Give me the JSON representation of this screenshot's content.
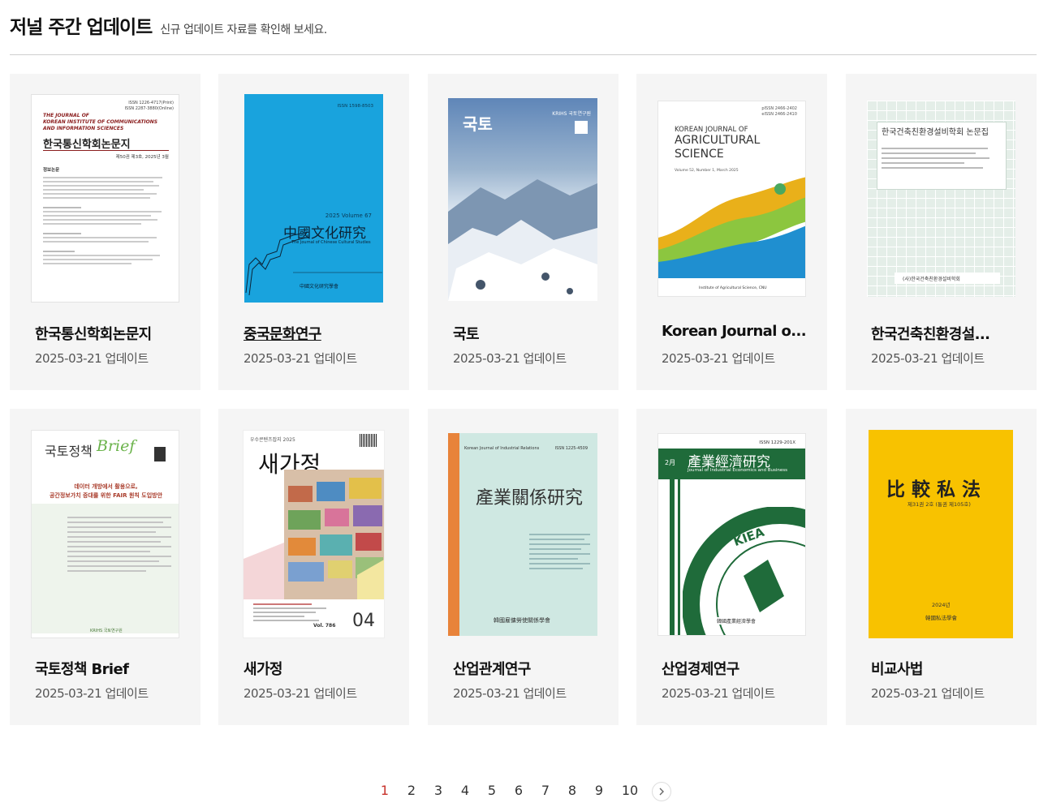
{
  "header": {
    "title": "저널 주간 업데이트",
    "subtitle": "신규 업데이트 자료를 확인해 보세요."
  },
  "journals": [
    {
      "name": "한국통신학회논문지",
      "date": "2025-03-21 업데이트",
      "cover": {
        "issn": "ISSN 1226-4717(Print)\nISSN 2287-3880(Online)",
        "en_title": "THE JOURNAL OF\nKOREAN INSTITUTE OF COMMUNICATIONS\nAND INFORMATION SCIENCES",
        "ko_title": "한국통신학회논문지",
        "issue": "제50권 제3호, 2025년 3월",
        "section": "정보논문"
      }
    },
    {
      "name": "중국문화연구",
      "date": "2025-03-21 업데이트",
      "cover": {
        "issn": "ISSN 1598-8503",
        "volume": "2025 Volume 67",
        "title": "中國文化研究",
        "subtitle": "The Journal of Chinese Cultural Studies",
        "publisher": "中國文化研究學會"
      }
    },
    {
      "name": "국토",
      "date": "2025-03-21 업데이트",
      "cover": {
        "title": "국토",
        "badge": "KRIHS 국토연구원"
      }
    },
    {
      "name": "Korean Journal o...",
      "date": "2025-03-21 업데이트",
      "cover": {
        "issn": "pISSN 2466-2402\neISSN 2466-2410",
        "line1": "KOREAN JOURNAL OF",
        "line2": "AGRICULTURAL",
        "line3": "SCIENCE",
        "volume": "Volume 52, Number 1, March 2025",
        "institute": "Institute of Agricultural Science, CNU"
      }
    },
    {
      "name": "한국건축친환경설...",
      "date": "2025-03-21 업데이트",
      "cover": {
        "title": "한국건축친환경설비학회 논문집",
        "publisher": "(사)한국건축친환경설비학회"
      }
    },
    {
      "name": "국토정책 Brief",
      "date": "2025-03-21 업데이트",
      "cover": {
        "title_ko": "국토정책",
        "title_en": "Brief",
        "headline": "데이터 개방에서 활용으로,\n공간정보가치 증대를 위한 FAIR 원칙 도입방안",
        "publisher": "KRIHS 국토연구원"
      }
    },
    {
      "name": "새가정",
      "date": "2025-03-21 업데이트",
      "cover": {
        "top": "우수콘텐츠잡지 2025",
        "title": "새가정",
        "vol": "Vol. 786",
        "month": "04"
      }
    },
    {
      "name": "산업관계연구",
      "date": "2025-03-21 업데이트",
      "cover": {
        "en_title": "Korean Journal of Industrial Relations",
        "issn": "ISSN 1225-4509",
        "title": "產業關係研究",
        "publisher": "韓國雇傭勞使關係學會"
      }
    },
    {
      "name": "산업경제연구",
      "date": "2025-03-21 업데이트",
      "cover": {
        "issn": "ISSN 1229-201X",
        "month": "2月",
        "title": "產業經濟研究",
        "subtitle": "Journal of Industrial Economics and Business",
        "ring": "KOREAN INDUSTRIAL ECONOMIC",
        "logo": "KIEA",
        "publisher": "韓國產業經濟學會"
      }
    },
    {
      "name": "비교사법",
      "date": "2025-03-21 업데이트",
      "cover": {
        "title": "比 較 私 法",
        "issue": "제31권 2호 (통권 제105호)",
        "year": "2024년",
        "publisher": "韓國私法學會"
      }
    }
  ],
  "pagination": {
    "pages": [
      "1",
      "2",
      "3",
      "4",
      "5",
      "6",
      "7",
      "8",
      "9",
      "10"
    ],
    "current": "1",
    "next_icon": "chevron-right-icon"
  },
  "colors": {
    "accent": "#c8322b",
    "card_bg": "#f5f5f5"
  }
}
